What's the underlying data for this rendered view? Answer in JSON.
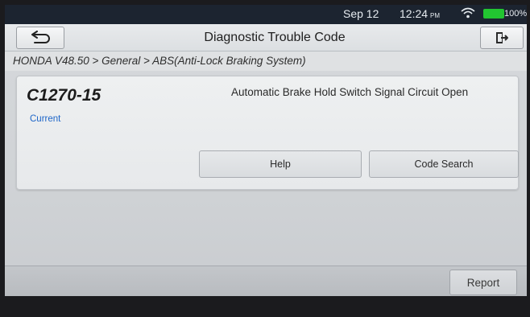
{
  "status_bar": {
    "date": "Sep 12",
    "time": "12:24",
    "ampm": "PM",
    "battery": "100%",
    "battery_color": "#22c531"
  },
  "header": {
    "title": "Diagnostic Trouble Code",
    "back_icon": "back-arrow-icon",
    "exit_icon": "exit-icon"
  },
  "breadcrumb": "HONDA V48.50 > General > ABS(Anti-Lock Braking System)",
  "dtc": {
    "code": "C1270-15",
    "status": "Current",
    "status_color": "#1e66c8",
    "description": "Automatic Brake Hold Switch Signal Circuit Open",
    "help_label": "Help",
    "code_search_label": "Code Search"
  },
  "footer": {
    "report_label": "Report"
  }
}
